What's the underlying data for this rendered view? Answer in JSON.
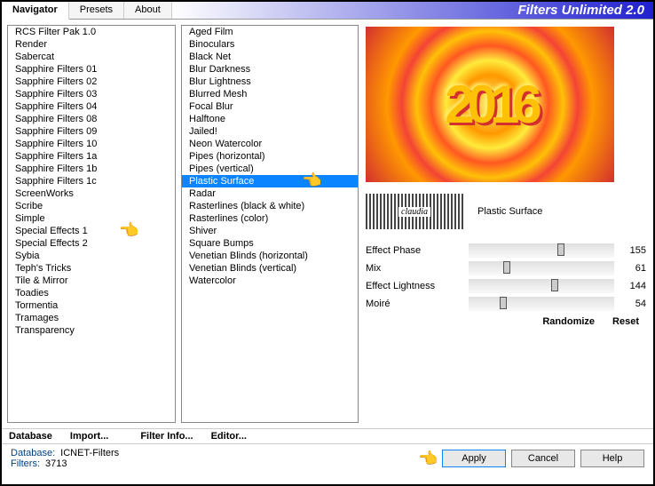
{
  "title": "Filters Unlimited 2.0",
  "tabs": {
    "navigator": "Navigator",
    "presets": "Presets",
    "about": "About"
  },
  "categories": [
    "RCS Filter Pak 1.0",
    "Render",
    "Sabercat",
    "Sapphire Filters 01",
    "Sapphire Filters 02",
    "Sapphire Filters 03",
    "Sapphire Filters 04",
    "Sapphire Filters 08",
    "Sapphire Filters 09",
    "Sapphire Filters 10",
    "Sapphire Filters 1a",
    "Sapphire Filters 1b",
    "Sapphire Filters 1c",
    "ScreenWorks",
    "Scribe",
    "Simple",
    "Special Effects 1",
    "Special Effects 2",
    "Sybia",
    "Teph's Tricks",
    "Tile & Mirror",
    "Toadies",
    "Tormentia",
    "Tramages",
    "Transparency"
  ],
  "filters": [
    "Aged Film",
    "Binoculars",
    "Black Net",
    "Blur Darkness",
    "Blur Lightness",
    "Blurred Mesh",
    "Focal Blur",
    "Halftone",
    "Jailed!",
    "Neon Watercolor",
    "Pipes (horizontal)",
    "Pipes (vertical)",
    "Plastic Surface",
    "Radar",
    "Rasterlines (black & white)",
    "Rasterlines (color)",
    "Shiver",
    "Square Bumps",
    "Venetian Blinds (horizontal)",
    "Venetian Blinds (vertical)",
    "Watercolor"
  ],
  "selected_category": "Special Effects 1",
  "selected_filter": "Plastic Surface",
  "preview_text": "2016",
  "current_filter_name": "Plastic Surface",
  "sliders": [
    {
      "label": "Effect Phase",
      "value": 155
    },
    {
      "label": "Mix",
      "value": 61
    },
    {
      "label": "Effect Lightness",
      "value": 144
    },
    {
      "label": "Moiré",
      "value": 54
    }
  ],
  "buttons": {
    "database": "Database",
    "import": "Import...",
    "filter_info": "Filter Info...",
    "editor": "Editor...",
    "randomize": "Randomize",
    "reset": "Reset",
    "apply": "Apply",
    "cancel": "Cancel",
    "help": "Help"
  },
  "footer": {
    "db_key": "Database:",
    "db_val": "ICNET-Filters",
    "filters_key": "Filters:",
    "filters_val": "3713"
  }
}
